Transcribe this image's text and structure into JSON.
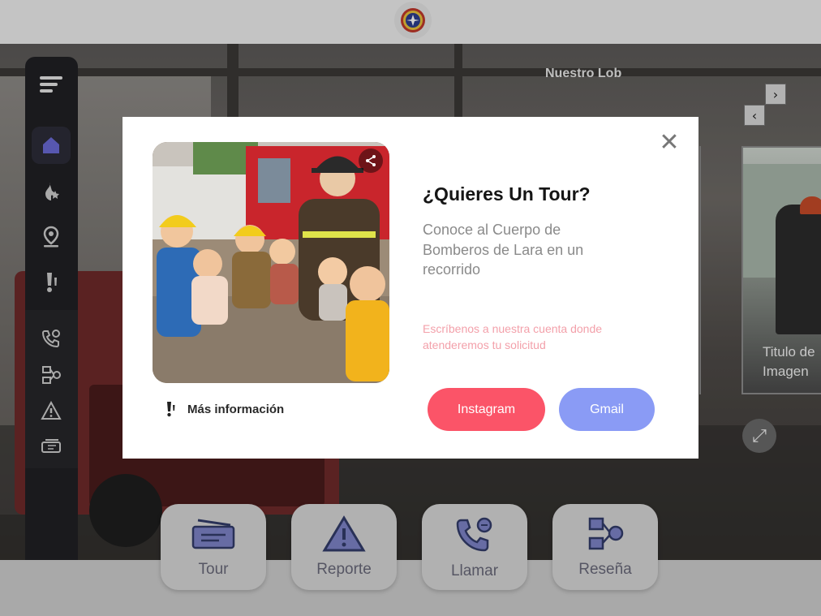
{
  "header": {
    "logo": "emblem-icon"
  },
  "background": {
    "section_title": "Nuestro Lob",
    "gallery_caption": "Titulo de Imagen",
    "prev_label": "‹",
    "next_label": "›"
  },
  "sidebar": {
    "items": [
      {
        "icon": "menu-icon"
      },
      {
        "icon": "home-icon"
      },
      {
        "icon": "fire-star-icon"
      },
      {
        "icon": "location-pin-icon"
      },
      {
        "icon": "exclamation-icon"
      },
      {
        "icon": "phone-chat-icon"
      },
      {
        "icon": "flow-diagram-icon"
      },
      {
        "icon": "warning-icon"
      },
      {
        "icon": "ticket-icon"
      }
    ],
    "close_label": "✕"
  },
  "dock": {
    "buttons": [
      {
        "label": "Tour",
        "icon": "ticket-icon"
      },
      {
        "label": "Reporte",
        "icon": "warning-icon"
      },
      {
        "label": "Llamar",
        "icon": "phone-chat-icon"
      },
      {
        "label": "Reseña",
        "icon": "flow-diagram-icon"
      }
    ]
  },
  "modal": {
    "title": "¿Quieres Un Tour?",
    "description": "Conoce al Cuerpo de Bomberos de Lara en un recorrido",
    "note": "Escríbenos a nuestra cuenta donde atenderemos tu solicitud",
    "more_info_label": "Más información",
    "instagram_label": "Instagram",
    "gmail_label": "Gmail",
    "close_label": "✕"
  },
  "colors": {
    "instagram": "#fb5468",
    "gmail": "#8a9bf5",
    "note": "#f3a0aa",
    "sidebar_accent": "#6b6bd6"
  }
}
